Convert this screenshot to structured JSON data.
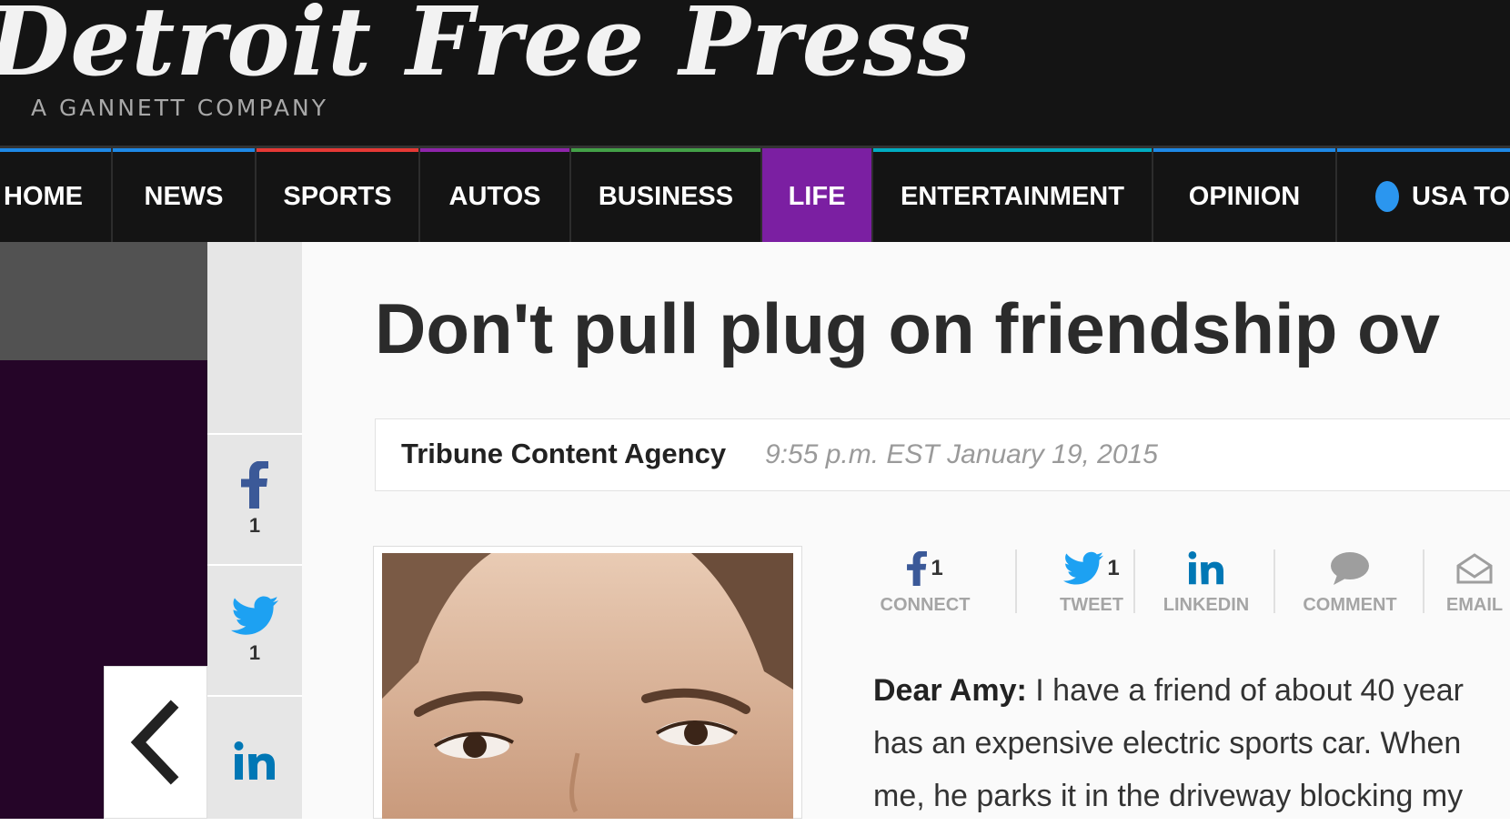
{
  "masthead": {
    "logo_text": "Detroit Free Press",
    "tagline": "A GANNETT COMPANY"
  },
  "nav": {
    "items": [
      {
        "label": "HOME",
        "stripe": "#1e88e5"
      },
      {
        "label": "NEWS",
        "stripe": "#1e88e5"
      },
      {
        "label": "SPORTS",
        "stripe": "#e53935"
      },
      {
        "label": "AUTOS",
        "stripe": "#8e24aa"
      },
      {
        "label": "BUSINESS",
        "stripe": "#43a047"
      },
      {
        "label": "LIFE",
        "stripe": "#7b1fa2",
        "active": true
      },
      {
        "label": "ENTERTAINMENT",
        "stripe": "#00acc1"
      },
      {
        "label": "OPINION",
        "stripe": "#1e88e5"
      },
      {
        "label": "USA TO",
        "stripe": "#1e88e5"
      }
    ]
  },
  "rail": {
    "facebook_count": "1",
    "twitter_count": "1"
  },
  "article": {
    "headline": "Don't pull plug on friendship ov",
    "author": "Tribune Content Agency",
    "timestamp": "9:55 p.m. EST January 19, 2015",
    "body": {
      "salutation": "Dear Amy:",
      "line1": "I have a friend of about 40 year",
      "line2": "has an expensive electric sports car. When",
      "line3": "me, he parks it in the driveway blocking my"
    }
  },
  "share_bar": {
    "connect_label": "CONNECT",
    "connect_count": "1",
    "tweet_label": "TWEET",
    "tweet_count": "1",
    "linkedin_label": "LINKEDIN",
    "comment_label": "COMMENT",
    "email_label": "EMAIL"
  },
  "colors": {
    "facebook": "#3b5998",
    "twitter": "#1da1f2",
    "linkedin": "#0077b5",
    "life_accent": "#7b1fa2"
  }
}
